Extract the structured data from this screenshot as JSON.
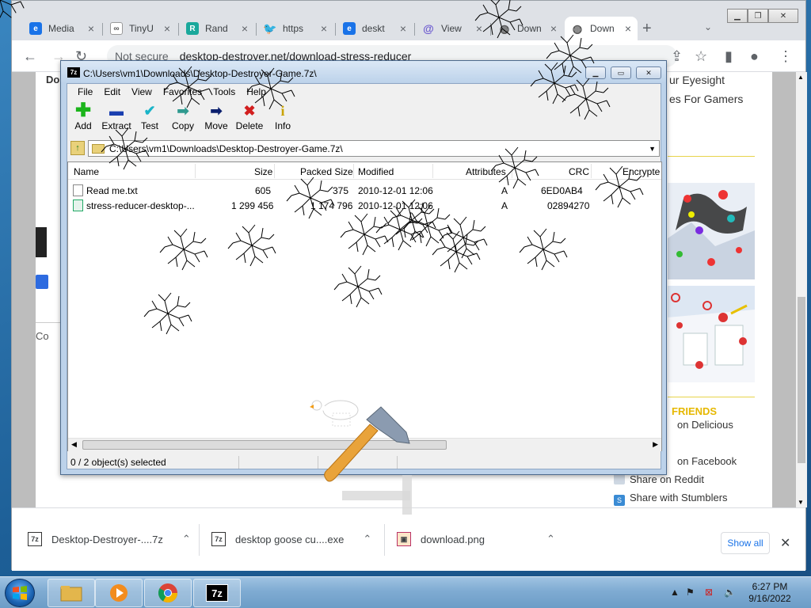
{
  "browser": {
    "tabs": [
      {
        "label": "Media",
        "favicon": "edge-icon",
        "color": "#1a73e8"
      },
      {
        "label": "TinyU",
        "favicon": "link-icon",
        "color": "#555555"
      },
      {
        "label": "Rand",
        "favicon": "r-icon",
        "color": "#1aa89c"
      },
      {
        "label": "https",
        "favicon": "twitter-icon",
        "color": "#1d9bf0"
      },
      {
        "label": "deskt",
        "favicon": "edge-icon",
        "color": "#1a73e8"
      },
      {
        "label": "View",
        "favicon": "at-icon",
        "color": "#6d5bd0"
      },
      {
        "label": "Down",
        "favicon": "globe-icon",
        "color": "#555555"
      },
      {
        "label": "Down",
        "favicon": "globe-icon",
        "color": "#555555",
        "active": true
      }
    ],
    "new_tab": "+",
    "address": {
      "security": "Not secure",
      "url": "desktop-destroyer.net/download-stress-reducer"
    }
  },
  "page": {
    "left_title": "Do",
    "left_footer": "Co",
    "side_links": [
      "ur Eyesight",
      "es For Gamers"
    ],
    "friends_heading": "FRIENDS",
    "share_items": [
      "on Delicious",
      "on Facebook",
      "Share on Reddit",
      "Share with Stumblers"
    ]
  },
  "downloads": [
    {
      "name": "Desktop-Destroyer-....7z",
      "icon": "7z-icon"
    },
    {
      "name": "desktop goose cu....exe",
      "icon": "7z-icon"
    },
    {
      "name": "download.png",
      "icon": "image-icon"
    }
  ],
  "downloads_show_all": "Show all",
  "zip": {
    "title": "C:\\Users\\vm1\\Downloads\\Desktop-Destroyer-Game.7z\\",
    "app_icon": "7z",
    "menu": [
      "File",
      "Edit",
      "View",
      "Favorites",
      "Tools",
      "Help"
    ],
    "tools": [
      {
        "label": "Add",
        "icon": "plus-icon",
        "glyph": "+",
        "color": "#1bb41b"
      },
      {
        "label": "Extract",
        "icon": "minus-icon",
        "glyph": "—",
        "color": "#1a3fb0"
      },
      {
        "label": "Test",
        "icon": "check-icon",
        "glyph": "✓",
        "color": "#1ab4c8"
      },
      {
        "label": "Copy",
        "icon": "copy-arrow-icon",
        "glyph": "➡",
        "color": "#2f9a8f"
      },
      {
        "label": "Move",
        "icon": "move-arrow-icon",
        "glyph": "➡",
        "color": "#0b1f6e"
      },
      {
        "label": "Delete",
        "icon": "delete-x-icon",
        "glyph": "✖",
        "color": "#d21f1f"
      },
      {
        "label": "Info",
        "icon": "info-icon",
        "glyph": "i",
        "color": "#c9a300"
      }
    ],
    "address": "C:\\Users\\vm1\\Downloads\\Desktop-Destroyer-Game.7z\\",
    "columns": [
      "Name",
      "Size",
      "Packed Size",
      "Modified",
      "Attributes",
      "CRC",
      "Encrypte"
    ],
    "rows": [
      {
        "name": "Read me.txt",
        "size": "605",
        "packed": "375",
        "modified": "2010-12-01 12:06",
        "attr": "A",
        "crc": "6ED0AB4"
      },
      {
        "name": "stress-reducer-desktop-...",
        "size": "1 299 456",
        "packed": "1 174 796",
        "modified": "2010-12-01 12:06",
        "attr": "A",
        "crc": "02894270"
      }
    ],
    "status": "0 / 2 object(s) selected"
  },
  "taskbar": {
    "clock_time": "6:27 PM",
    "clock_date": "9/16/2022",
    "pinned": [
      "explorer-icon",
      "media-player-icon",
      "chrome-icon",
      "7zip-icon"
    ]
  }
}
